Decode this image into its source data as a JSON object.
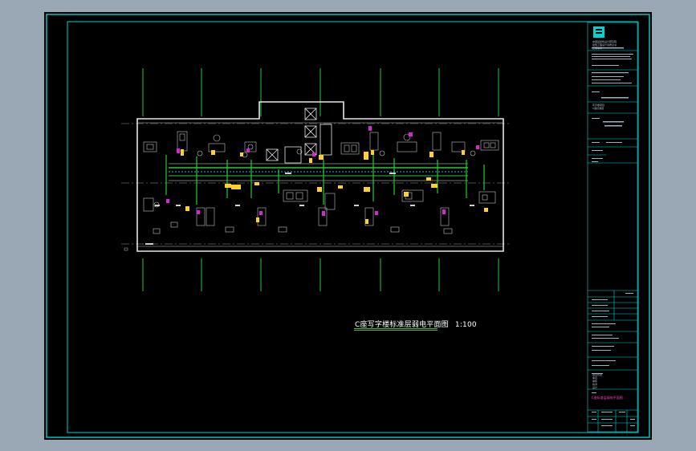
{
  "drawing": {
    "caption": "C座写字楼标准层弱电平面图",
    "scale": "1:100"
  },
  "title_block": {
    "company_lines": [
      "中国某建筑设计研究院",
      "建筑工程设计资质证书",
      "工程编号"
    ],
    "project_lines": [
      "写字楼项目",
      "C座标准层"
    ],
    "drawing_title": "C座标准层弱电平面图",
    "rows": [
      "项目负责",
      "审定",
      "审核",
      "校对",
      "设计",
      "制图"
    ]
  },
  "colors": {
    "background": "#000000",
    "frame": "#00d5d5",
    "walls": "#e6e6e6",
    "axis": "#22cc33",
    "cable": "#22cc33",
    "device": "#ffd21f",
    "outlet": "#dd22dd",
    "furniture": "#bfbfbf",
    "outer_margin": "#9aa8b6"
  }
}
